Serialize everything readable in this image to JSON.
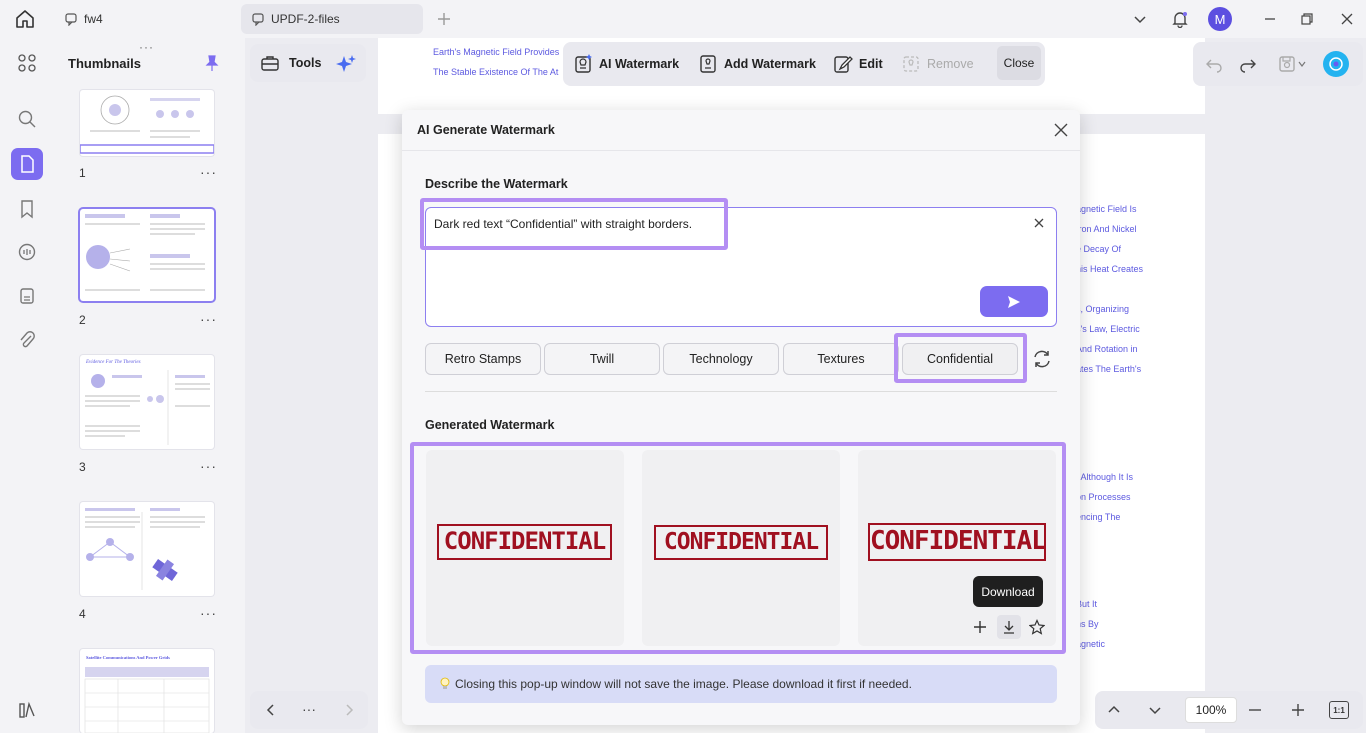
{
  "titlebar": {
    "tabs": [
      {
        "label": "fw4"
      },
      {
        "label": "UPDF-2-files"
      }
    ],
    "avatar_initial": "M"
  },
  "thumbnails": {
    "title": "Thumbnails",
    "pages": [
      "1",
      "2",
      "3",
      "4"
    ],
    "thumb3_heading": "Evidence For The Theories",
    "thumb5_heading": "Satellite Communications And Power Grids",
    "more": "···"
  },
  "toolbar": {
    "tools_label": "Tools",
    "ai_watermark": "AI Watermark",
    "add_watermark": "Add Watermark",
    "edit": "Edit",
    "remove": "Remove",
    "close": "Close"
  },
  "document": {
    "top_lines": [
      "Earth's Magnetic Field Provides",
      "The Stable Existence Of The At"
    ],
    "right_lines_1": [
      "agnetic Field Is",
      "Iron And Nickel",
      "e Decay Of",
      "his Heat Creates"
    ],
    "right_lines_2": [
      "s, Organizing",
      "s's Law, Electric",
      "And Rotation in",
      "ates The Earth's"
    ],
    "right_lines_3": [
      ", Although It Is",
      "on Processes",
      "encing The"
    ],
    "right_lines_4": [
      "But It",
      "ns By",
      "agnetic"
    ]
  },
  "modal": {
    "title": "AI Generate Watermark",
    "describe_label": "Describe the Watermark",
    "prompt_text": "Dark red text “Confidential” with straight borders.",
    "chips": [
      "Retro Stamps",
      "Twill",
      "Technology",
      "Textures",
      "Confidential"
    ],
    "generated_label": "Generated Watermark",
    "watermark_text": "CONFIDENTIAL",
    "tooltip": "Download",
    "notice": "Closing this pop-up window will not save the image. Please download it first if needed."
  },
  "zoom": {
    "value": "100%",
    "fit_label": "1:1"
  },
  "colors": {
    "accent": "#7c6cf0",
    "highlight": "#b48ef3",
    "stamp_red": "#a01020",
    "doc_link_blue": "#5d5ae0"
  }
}
